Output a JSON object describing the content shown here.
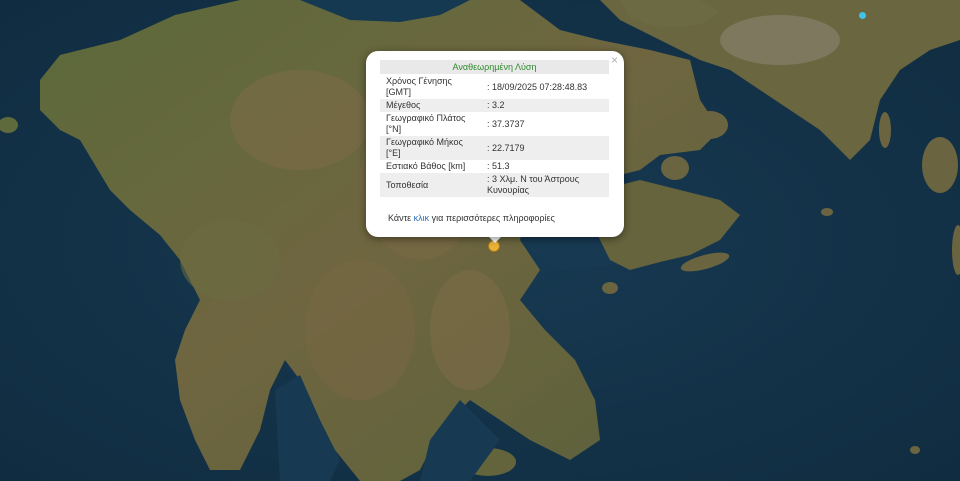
{
  "popup": {
    "title": "Αναθεωρημένη Λύση",
    "close_symbol": "×",
    "rows": [
      {
        "label": "Χρόνος Γένησης [GMT]",
        "value": ": 18/09/2025 07:28:48.83"
      },
      {
        "label": "Μέγεθος",
        "value": ": 3.2"
      },
      {
        "label": "Γεωγραφικό Πλάτος [°N]",
        "value": ": 37.3737"
      },
      {
        "label": "Γεωγραφικό Μήκος [°E]",
        "value": ": 22.7179"
      },
      {
        "label": "Εστιακό Βάθος [km]",
        "value": ": 51.3"
      },
      {
        "label": "Τοποθεσία",
        "value": ": 3 Χλμ. Ν του Άστρους Κυνουρίας"
      }
    ],
    "more_prefix": "Κάντε ",
    "more_link": "κλικ",
    "more_suffix": " για περισσότερες πληροφορίες"
  },
  "colors": {
    "sea": "#14344a",
    "land": "#5f6a3c",
    "mountain": "#7a6b45",
    "marker_main": "#e9b33a",
    "marker_other": "#3fc4e8",
    "title_text": "#2e8b2e",
    "link": "#2a6fb4"
  },
  "markers": [
    {
      "name": "earthquake-epicenter",
      "color": "#e9b33a"
    },
    {
      "name": "other-earthquake",
      "color": "#3fc4e8"
    }
  ]
}
